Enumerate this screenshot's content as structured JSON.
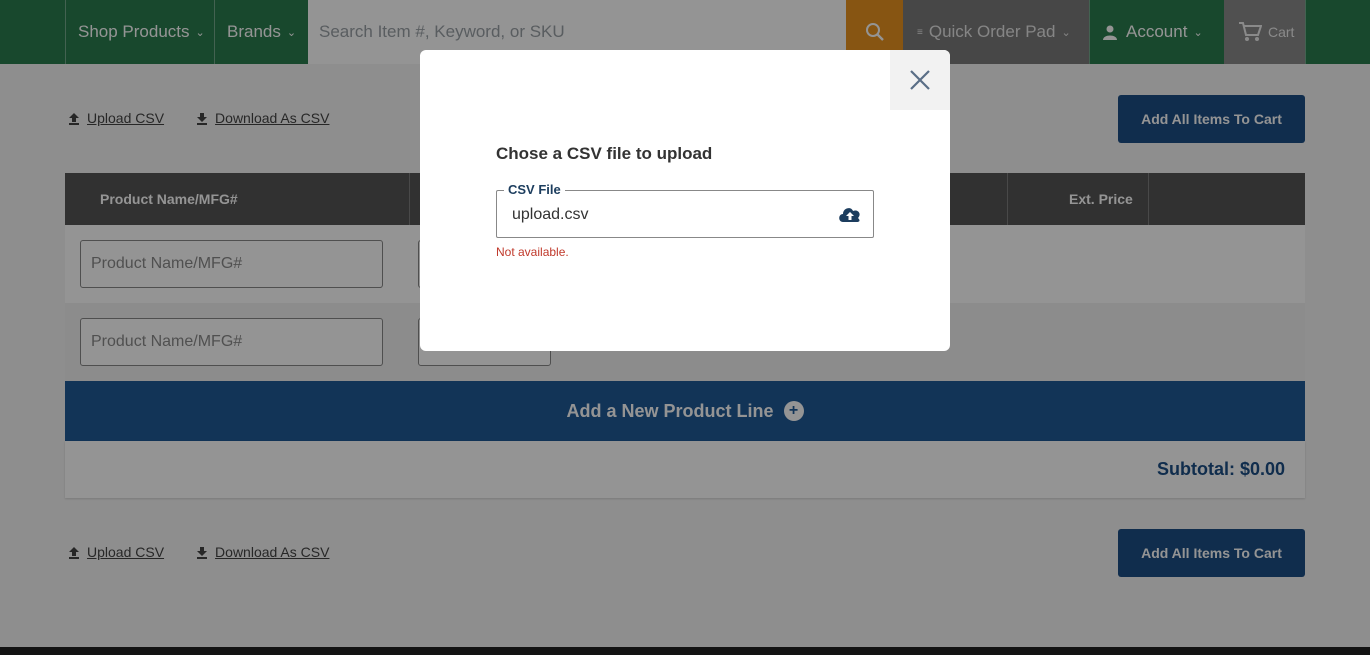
{
  "nav": {
    "shop_products": "Shop Products",
    "brands": "Brands",
    "search_placeholder": "Search Item #, Keyword, or SKU",
    "quick_order_pad": "Quick Order Pad",
    "account": "Account",
    "cart": "Cart"
  },
  "actions": {
    "upload_csv": "Upload CSV",
    "download_csv": "Download As CSV",
    "add_all_to_cart": "Add All Items To Cart"
  },
  "table": {
    "col_product": "Product Name/MFG#",
    "col_ext_price": "Ext. Price",
    "rows": [
      {
        "placeholder": "Product Name/MFG#"
      },
      {
        "placeholder": "Product Name/MFG#"
      }
    ],
    "add_line": "Add a New Product Line",
    "subtotal": "Subtotal: $0.00"
  },
  "modal": {
    "title": "Chose a CSV file to upload",
    "field_label": "CSV File",
    "field_value": "upload.csv",
    "error": "Not available."
  },
  "colors": {
    "nav_green": "#2a7d4f",
    "search_orange": "#e8931f",
    "primary_blue": "#1c4f86",
    "error_red": "#c0392b"
  }
}
